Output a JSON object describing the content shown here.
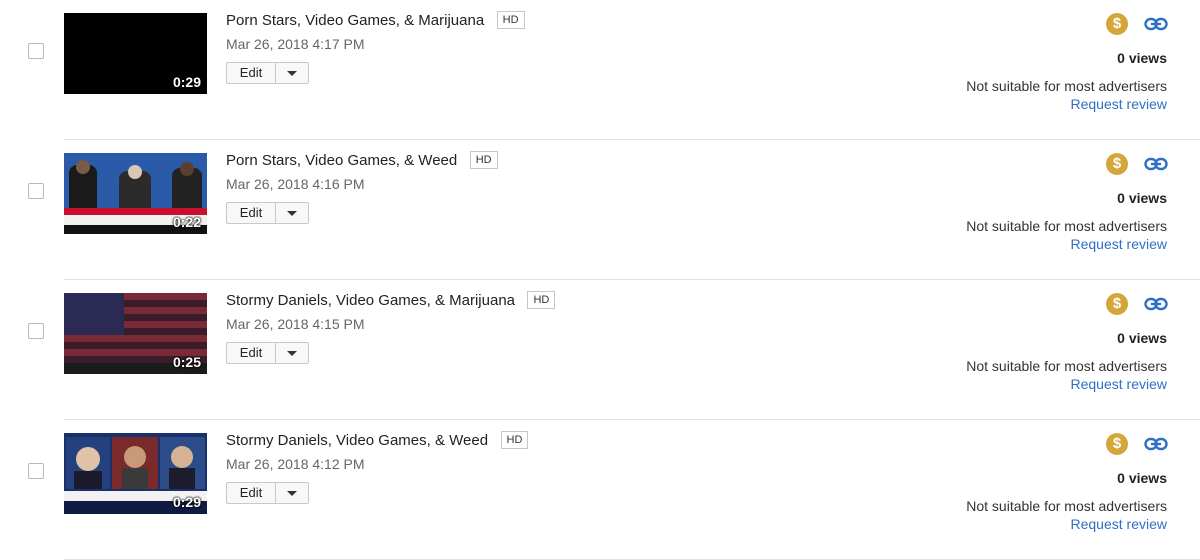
{
  "videos": [
    {
      "title": "Porn Stars, Video Games, & Marijuana",
      "quality_badge": "HD",
      "timestamp": "Mar 26, 2018 4:17 PM",
      "duration": "0:29",
      "thumbnail": "black-frame",
      "edit_label": "Edit",
      "views": "0 views",
      "ad_status": "Not suitable for most advertisers",
      "request_review_label": "Request review",
      "monetize_icon": "$"
    },
    {
      "title": "Porn Stars, Video Games, & Weed",
      "quality_badge": "HD",
      "timestamp": "Mar 26, 2018 4:16 PM",
      "duration": "0:22",
      "thumbnail": "news-panel-three-people",
      "edit_label": "Edit",
      "views": "0 views",
      "ad_status": "Not suitable for most advertisers",
      "request_review_label": "Request review",
      "monetize_icon": "$"
    },
    {
      "title": "Stormy Daniels, Video Games, & Marijuana",
      "quality_badge": "HD",
      "timestamp": "Mar 26, 2018 4:15 PM",
      "duration": "0:25",
      "thumbnail": "flag-background-with-text",
      "edit_label": "Edit",
      "views": "0 views",
      "ad_status": "Not suitable for most advertisers",
      "request_review_label": "Request review",
      "monetize_icon": "$"
    },
    {
      "title": "Stormy Daniels, Video Games, & Weed",
      "quality_badge": "HD",
      "timestamp": "Mar 26, 2018 4:12 PM",
      "duration": "0:29",
      "thumbnail": "news-split-screen",
      "edit_label": "Edit",
      "views": "0 views",
      "ad_status": "Not suitable for most advertisers",
      "request_review_label": "Request review",
      "monetize_icon": "$"
    }
  ],
  "colors": {
    "monetize": "#d4a63a",
    "link": "#2f6fc6",
    "divider": "#e2e2e2"
  }
}
